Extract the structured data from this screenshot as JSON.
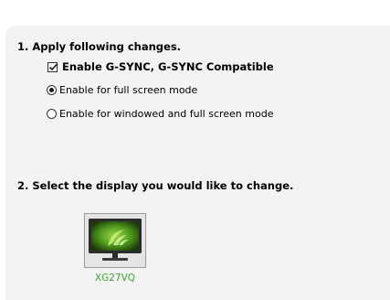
{
  "step1": {
    "heading": "1. Apply following changes.",
    "checkbox": {
      "label": "Enable G-SYNC, G-SYNC Compatible",
      "checked": true
    },
    "radios": [
      {
        "label": "Enable for full screen mode",
        "selected": true
      },
      {
        "label": "Enable for windowed and full screen mode",
        "selected": false
      }
    ]
  },
  "step2": {
    "heading": "2. Select the display you would like to change.",
    "displays": [
      {
        "name": "XG27VQ",
        "selected": true
      }
    ]
  },
  "colors": {
    "panel_bg": "#f3f3f3",
    "display_label": "#3aa630",
    "nvidia_green": "#76b900"
  }
}
